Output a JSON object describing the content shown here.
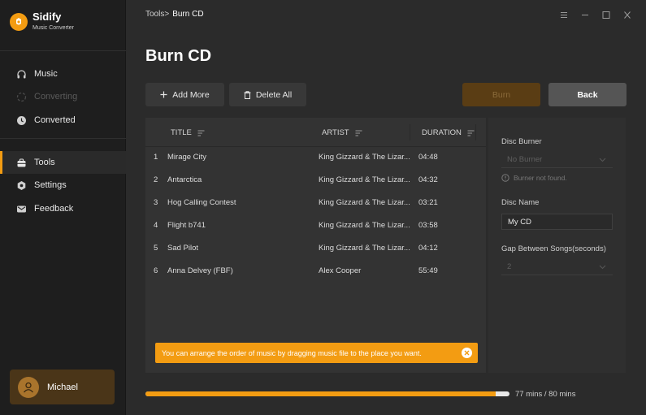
{
  "app": {
    "name": "Sidify",
    "subtitle": "Music Converter"
  },
  "sidebar": {
    "items": [
      {
        "label": "Music",
        "icon": "headphones-icon",
        "state": "normal"
      },
      {
        "label": "Converting",
        "icon": "converting-icon",
        "state": "disabled"
      },
      {
        "label": "Converted",
        "icon": "clock-icon",
        "state": "normal"
      },
      {
        "label": "Tools",
        "icon": "toolbox-icon",
        "state": "active"
      },
      {
        "label": "Settings",
        "icon": "gear-icon",
        "state": "normal"
      },
      {
        "label": "Feedback",
        "icon": "mail-icon",
        "state": "normal"
      }
    ]
  },
  "user": {
    "name": "Michael"
  },
  "breadcrumb": {
    "parent": "Tools",
    "separator": ">",
    "current": "Burn CD"
  },
  "page": {
    "title": "Burn CD"
  },
  "toolbar": {
    "add_more": "Add More",
    "delete_all": "Delete All",
    "burn": "Burn",
    "back": "Back"
  },
  "table": {
    "headers": {
      "title": "TITLE",
      "artist": "ARTIST",
      "duration": "DURATION"
    },
    "rows": [
      {
        "index": "1",
        "title": "Mirage City",
        "artist": "King Gizzard & The Lizar...",
        "duration": "04:48"
      },
      {
        "index": "2",
        "title": "Antarctica",
        "artist": "King Gizzard & The Lizar...",
        "duration": "04:32"
      },
      {
        "index": "3",
        "title": "Hog Calling Contest",
        "artist": "King Gizzard & The Lizar...",
        "duration": "03:21"
      },
      {
        "index": "4",
        "title": "Flight b741",
        "artist": "King Gizzard & The Lizar...",
        "duration": "03:58"
      },
      {
        "index": "5",
        "title": "Sad Pilot",
        "artist": "King Gizzard & The Lizar...",
        "duration": "04:12"
      },
      {
        "index": "6",
        "title": "Anna Delvey (FBF)",
        "artist": "Alex Cooper",
        "duration": "55:49"
      }
    ]
  },
  "hint": {
    "text": "You can arrange the order of music by dragging music file to the place you want."
  },
  "settings": {
    "disc_burner_label": "Disc Burner",
    "disc_burner_value": "No Burner",
    "burner_warning": "Burner not found.",
    "disc_name_label": "Disc Name",
    "disc_name_value": "My CD",
    "gap_label": "Gap Between Songs(seconds)",
    "gap_value": "2"
  },
  "progress": {
    "text": "77 mins / 80 mins",
    "fraction": 0.9625
  },
  "colors": {
    "accent": "#f39c12",
    "background": "#2b2b2b",
    "sidebar": "#1e1e1e"
  }
}
